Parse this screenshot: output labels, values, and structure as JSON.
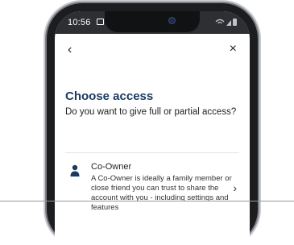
{
  "status_bar": {
    "time": "10:56"
  },
  "nav": {
    "back_label": "‹",
    "close_label": "×"
  },
  "header": {
    "title": "Choose access",
    "subtitle": "Do you want to give full or partial access?"
  },
  "options": [
    {
      "icon": "person-icon",
      "title": "Co-Owner",
      "description": "A Co-Owner is ideally a family member or close friend you can trust to share the account with you - including settings and features",
      "chevron": "›"
    }
  ],
  "colors": {
    "title": "#1a3a5f",
    "status_bar": "#2d2f33",
    "icon": "#1a3a5f"
  }
}
